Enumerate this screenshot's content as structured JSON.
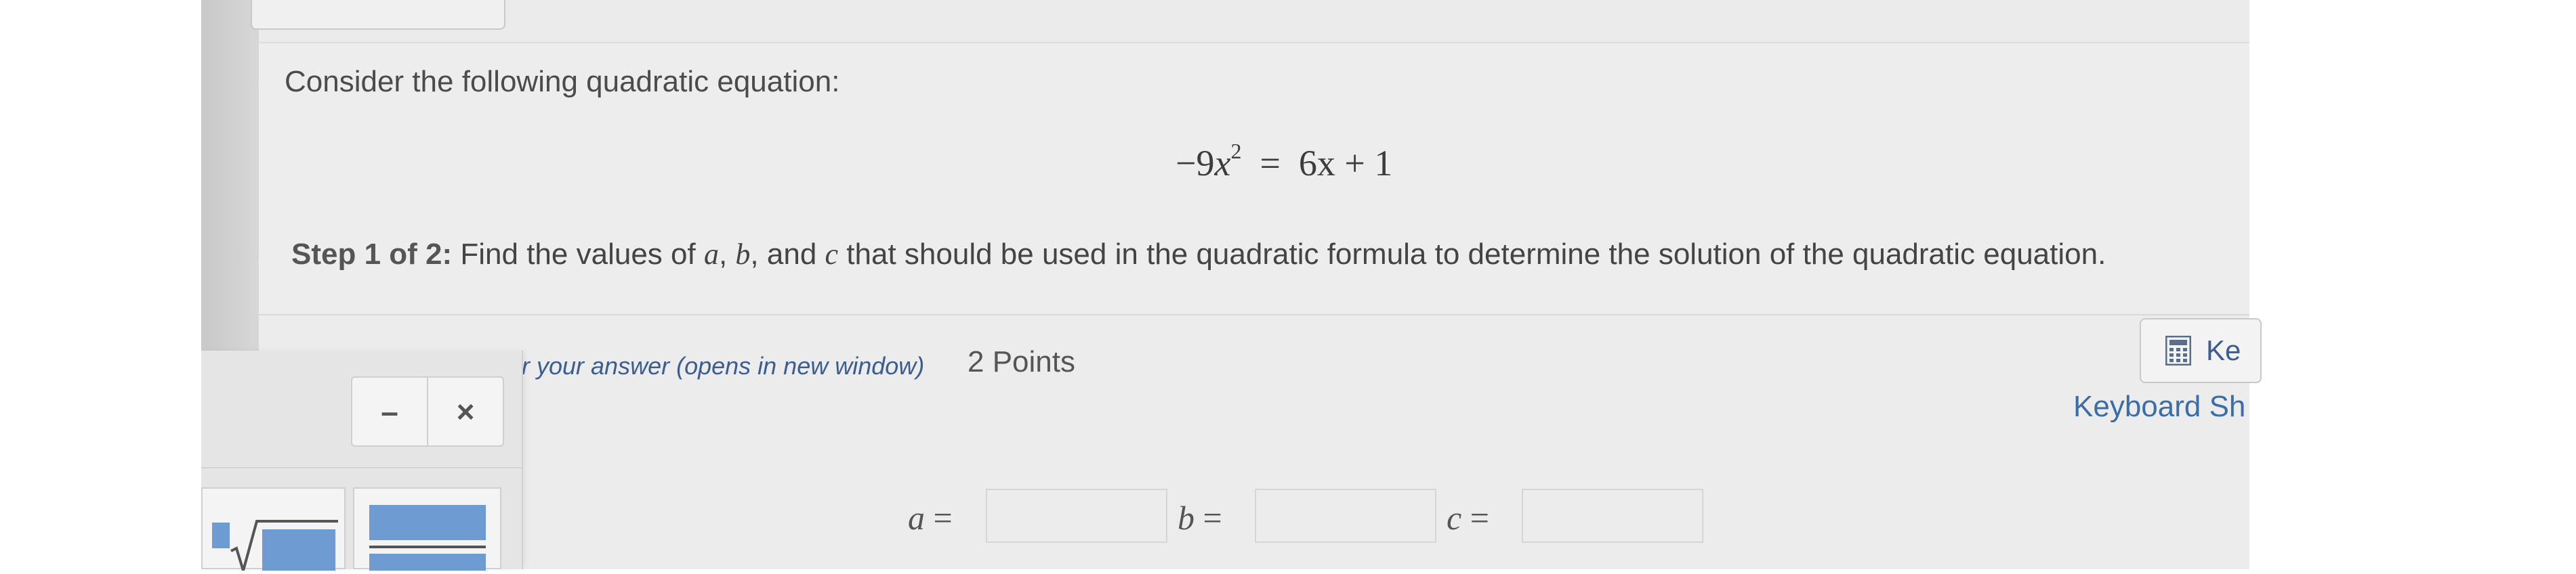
{
  "question": {
    "prompt": "Consider the following quadratic equation:",
    "equation": {
      "lhs_sign": "−",
      "lhs_coefficient": "9",
      "lhs_variable": "x",
      "lhs_exponent": "2",
      "equals": "=",
      "rhs_term1": "6x",
      "rhs_plus": "+",
      "rhs_constant": "1"
    },
    "step": {
      "label": "Step 1 of 2:",
      "text_part1": "Find the values of",
      "var_a": "a",
      "comma1": ",",
      "var_b": "b",
      "comma_and": ", and",
      "var_c": "c",
      "text_part2": "that should be used in the quadratic formula to determine the solution of the quadratic equation."
    }
  },
  "answer": {
    "help_link": "r your answer (opens in new window)",
    "points": "2 Points",
    "keypad_button_label": "Ke",
    "keyboard_shortcuts_link": "Keyboard Sh",
    "fields": [
      {
        "var": "a",
        "equals": "=",
        "value": ""
      },
      {
        "var": "b",
        "equals": "=",
        "value": ""
      },
      {
        "var": "c",
        "equals": "=",
        "value": ""
      }
    ]
  },
  "palette": {
    "minimize_label": "–",
    "close_label": "×"
  },
  "colors": {
    "link": "#3b5d8f",
    "accent_blue": "#6f9bd3",
    "background": "#ebebeb"
  }
}
